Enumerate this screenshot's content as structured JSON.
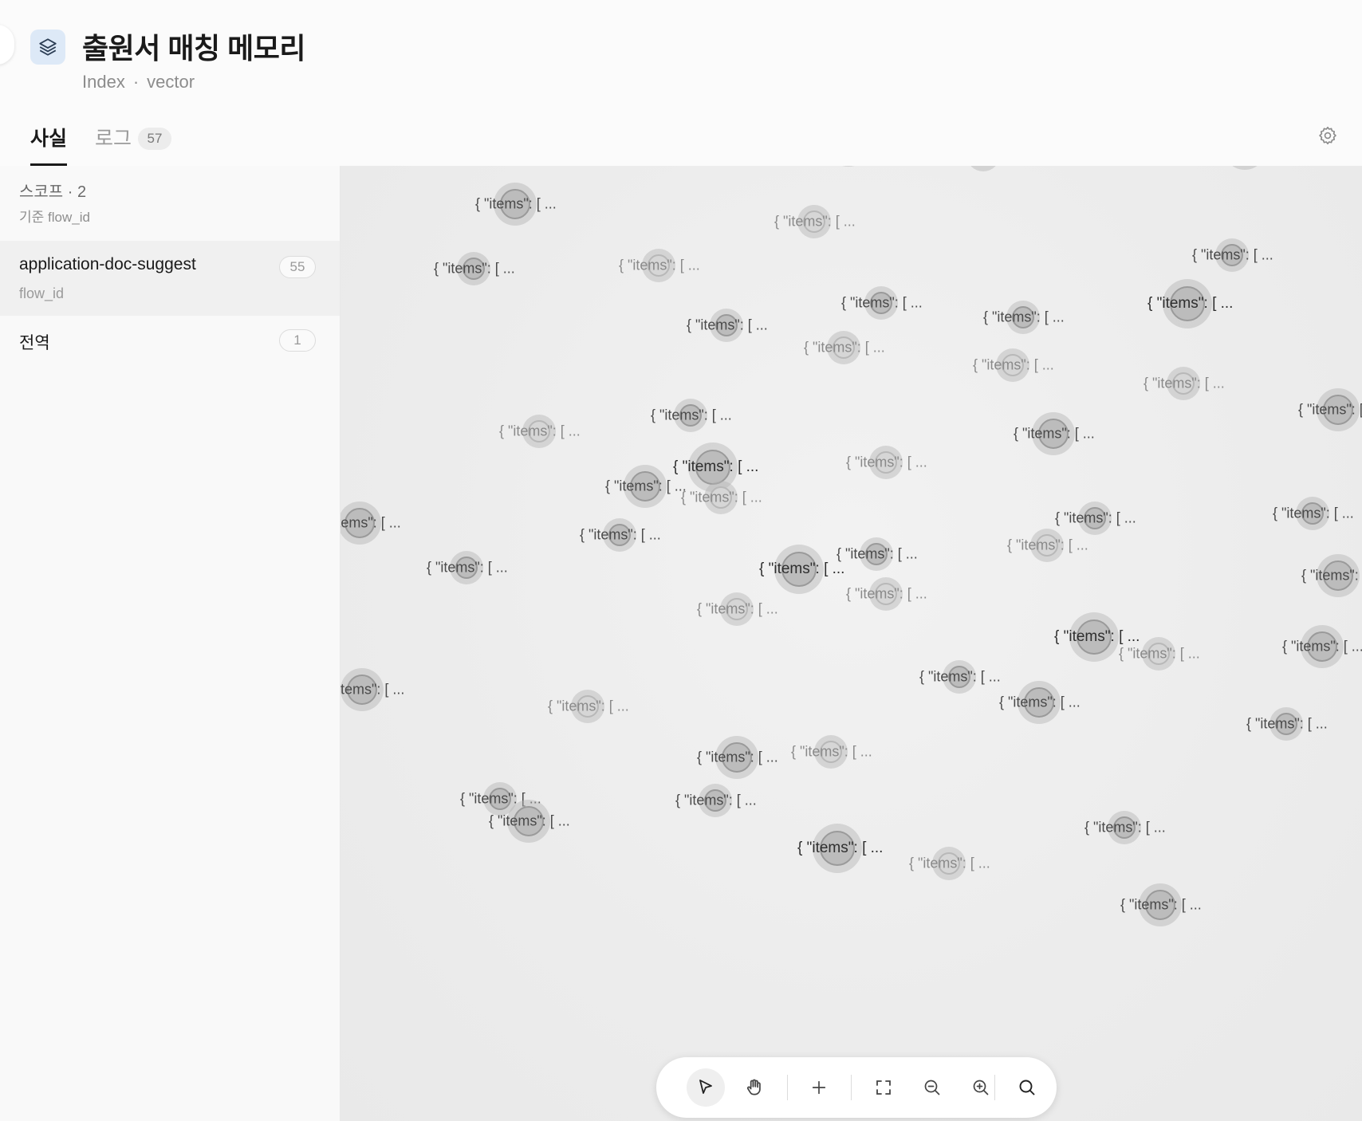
{
  "header": {
    "title": "출원서 매칭 메모리",
    "subtitle_type": "Index",
    "subtitle_separator": "·",
    "subtitle_kind": "vector"
  },
  "tabs": {
    "facts_label": "사실",
    "logs_label": "로그",
    "logs_count": "57"
  },
  "sidebar": {
    "scope_heading": "스코프 · 2",
    "scope_basis": "기준 flow_id",
    "items": [
      {
        "name": "application-doc-suggest",
        "key": "flow_id",
        "count": "55"
      },
      {
        "name": "전역",
        "count": "1"
      }
    ]
  },
  "canvas": {
    "node_label": "{ \"items\": [ ...",
    "node_label_clipped_left": "tems\": [ ...",
    "node_label_clipped_right": "{ \"items\":"
  },
  "icons": {
    "index": "layers-icon",
    "settings": "gear-icon",
    "toolbar": [
      "pointer-icon",
      "hand-icon",
      "plus-icon",
      "fit-view-icon",
      "zoom-out-icon",
      "zoom-in-icon",
      "search-icon"
    ]
  }
}
